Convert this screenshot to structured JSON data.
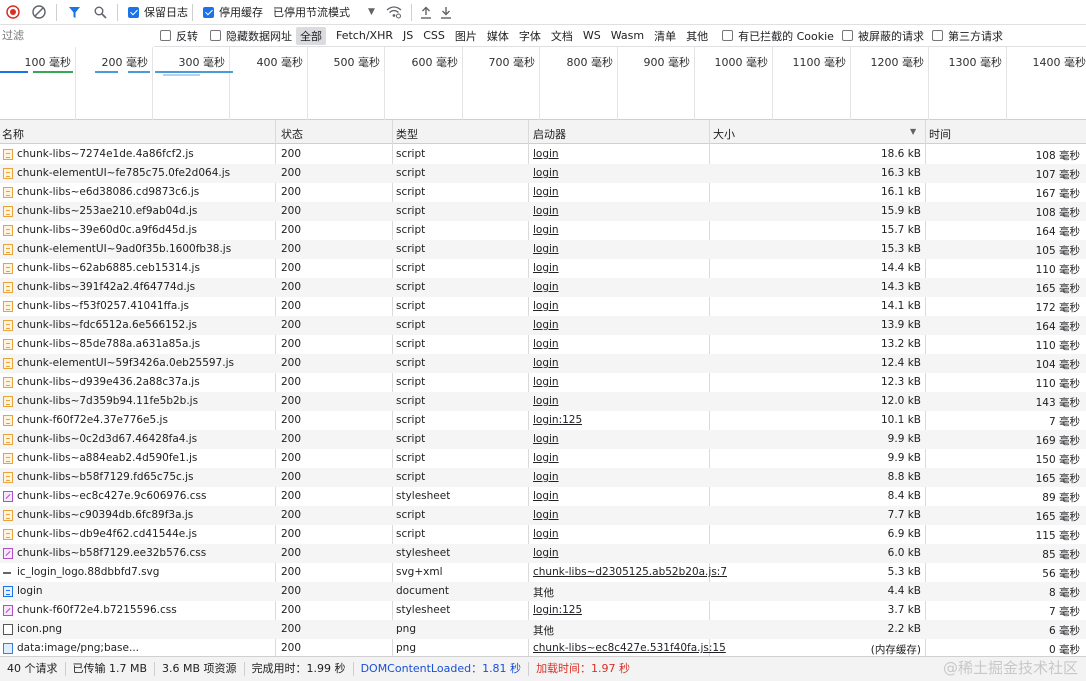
{
  "toolbar": {
    "preserve_log": "保留日志",
    "disable_cache": "停用缓存",
    "throttle": "已停用节流模式"
  },
  "filter": {
    "placeholder": "过滤",
    "invert": "反转",
    "hide_data_urls": "隐藏数据网址",
    "types": [
      "全部",
      "Fetch/XHR",
      "JS",
      "CSS",
      "图片",
      "媒体",
      "字体",
      "文档",
      "WS",
      "Wasm",
      "清单",
      "其他"
    ],
    "blocked_cookies": "有已拦截的 Cookie",
    "blocked_requests": "被屏蔽的请求",
    "third_party": "第三方请求"
  },
  "timeline": {
    "ticks": [
      "100 毫秒",
      "200 毫秒",
      "300 毫秒",
      "400 毫秒",
      "500 毫秒",
      "600 毫秒",
      "700 毫秒",
      "800 毫秒",
      "900 毫秒",
      "1000 毫秒",
      "1100 毫秒",
      "1200 毫秒",
      "1300 毫秒",
      "1400 毫秒"
    ]
  },
  "columns": {
    "name": "名称",
    "status": "状态",
    "type": "类型",
    "initiator": "启动器",
    "size": "大小",
    "time": "时间"
  },
  "requests": [
    {
      "name": "chunk-libs~7274e1de.4a86fcf2.js",
      "status": "200",
      "type": "script",
      "initiator": "login",
      "size": "18.6 kB",
      "time": "108 毫秒",
      "icon": "script"
    },
    {
      "name": "chunk-elementUI~fe785c75.0fe2d064.js",
      "status": "200",
      "type": "script",
      "initiator": "login",
      "size": "16.3 kB",
      "time": "107 毫秒",
      "icon": "script"
    },
    {
      "name": "chunk-libs~e6d38086.cd9873c6.js",
      "status": "200",
      "type": "script",
      "initiator": "login",
      "size": "16.1 kB",
      "time": "167 毫秒",
      "icon": "script"
    },
    {
      "name": "chunk-libs~253ae210.ef9ab04d.js",
      "status": "200",
      "type": "script",
      "initiator": "login",
      "size": "15.9 kB",
      "time": "108 毫秒",
      "icon": "script"
    },
    {
      "name": "chunk-libs~39e60d0c.a9f6d45d.js",
      "status": "200",
      "type": "script",
      "initiator": "login",
      "size": "15.7 kB",
      "time": "164 毫秒",
      "icon": "script"
    },
    {
      "name": "chunk-elementUI~9ad0f35b.1600fb38.js",
      "status": "200",
      "type": "script",
      "initiator": "login",
      "size": "15.3 kB",
      "time": "105 毫秒",
      "icon": "script"
    },
    {
      "name": "chunk-libs~62ab6885.ceb15314.js",
      "status": "200",
      "type": "script",
      "initiator": "login",
      "size": "14.4 kB",
      "time": "110 毫秒",
      "icon": "script"
    },
    {
      "name": "chunk-libs~391f42a2.4f64774d.js",
      "status": "200",
      "type": "script",
      "initiator": "login",
      "size": "14.3 kB",
      "time": "165 毫秒",
      "icon": "script"
    },
    {
      "name": "chunk-libs~f53f0257.41041ffa.js",
      "status": "200",
      "type": "script",
      "initiator": "login",
      "size": "14.1 kB",
      "time": "172 毫秒",
      "icon": "script"
    },
    {
      "name": "chunk-libs~fdc6512a.6e566152.js",
      "status": "200",
      "type": "script",
      "initiator": "login",
      "size": "13.9 kB",
      "time": "164 毫秒",
      "icon": "script"
    },
    {
      "name": "chunk-libs~85de788a.a631a85a.js",
      "status": "200",
      "type": "script",
      "initiator": "login",
      "size": "13.2 kB",
      "time": "110 毫秒",
      "icon": "script"
    },
    {
      "name": "chunk-elementUI~59f3426a.0eb25597.js",
      "status": "200",
      "type": "script",
      "initiator": "login",
      "size": "12.4 kB",
      "time": "104 毫秒",
      "icon": "script"
    },
    {
      "name": "chunk-libs~d939e436.2a88c37a.js",
      "status": "200",
      "type": "script",
      "initiator": "login",
      "size": "12.3 kB",
      "time": "110 毫秒",
      "icon": "script"
    },
    {
      "name": "chunk-libs~7d359b94.11fe5b2b.js",
      "status": "200",
      "type": "script",
      "initiator": "login",
      "size": "12.0 kB",
      "time": "143 毫秒",
      "icon": "script"
    },
    {
      "name": "chunk-f60f72e4.37e776e5.js",
      "status": "200",
      "type": "script",
      "initiator": "login:125",
      "size": "10.1 kB",
      "time": "7 毫秒",
      "icon": "script"
    },
    {
      "name": "chunk-libs~0c2d3d67.46428fa4.js",
      "status": "200",
      "type": "script",
      "initiator": "login",
      "size": "9.9 kB",
      "time": "169 毫秒",
      "icon": "script"
    },
    {
      "name": "chunk-libs~a884eab2.4d590fe1.js",
      "status": "200",
      "type": "script",
      "initiator": "login",
      "size": "9.9 kB",
      "time": "150 毫秒",
      "icon": "script"
    },
    {
      "name": "chunk-libs~b58f7129.fd65c75c.js",
      "status": "200",
      "type": "script",
      "initiator": "login",
      "size": "8.8 kB",
      "time": "165 毫秒",
      "icon": "script"
    },
    {
      "name": "chunk-libs~ec8c427e.9c606976.css",
      "status": "200",
      "type": "stylesheet",
      "initiator": "login",
      "size": "8.4 kB",
      "time": "89 毫秒",
      "icon": "css"
    },
    {
      "name": "chunk-libs~c90394db.6fc89f3a.js",
      "status": "200",
      "type": "script",
      "initiator": "login",
      "size": "7.7 kB",
      "time": "165 毫秒",
      "icon": "script"
    },
    {
      "name": "chunk-libs~db9e4f62.cd41544e.js",
      "status": "200",
      "type": "script",
      "initiator": "login",
      "size": "6.9 kB",
      "time": "115 毫秒",
      "icon": "script"
    },
    {
      "name": "chunk-libs~b58f7129.ee32b576.css",
      "status": "200",
      "type": "stylesheet",
      "initiator": "login",
      "size": "6.0 kB",
      "time": "85 毫秒",
      "icon": "css"
    },
    {
      "name": "ic_login_logo.88dbbfd7.svg",
      "status": "200",
      "type": "svg+xml",
      "initiator": "chunk-libs~d2305125.ab52b20a.js:7",
      "size": "5.3 kB",
      "time": "56 毫秒",
      "icon": "svg"
    },
    {
      "name": "login",
      "status": "200",
      "type": "document",
      "initiator": "其他",
      "size": "4.4 kB",
      "time": "8 毫秒",
      "icon": "doc"
    },
    {
      "name": "chunk-f60f72e4.b7215596.css",
      "status": "200",
      "type": "stylesheet",
      "initiator": "login:125",
      "size": "3.7 kB",
      "time": "7 毫秒",
      "icon": "css"
    },
    {
      "name": "icon.png",
      "status": "200",
      "type": "png",
      "initiator": "其他",
      "size": "2.2 kB",
      "time": "6 毫秒",
      "icon": "png"
    },
    {
      "name": "data:image/png;base...",
      "status": "200",
      "type": "png",
      "initiator": "chunk-libs~ec8c427e.531f40fa.js:15",
      "size": "(内存缓存)",
      "time": "0 毫秒",
      "icon": "img"
    }
  ],
  "status": {
    "requests": "40 个请求",
    "transferred": "已传输 1.7 MB",
    "resources": "3.6 MB 项资源",
    "finish": "完成用时：1.99 秒",
    "dcl": "DOMContentLoaded：1.81 秒",
    "load": "加载时间：1.97 秒"
  },
  "watermark": "@稀土掘金技术社区",
  "colors": {
    "record": "#d93025",
    "filter": "#1a73e8",
    "dcl": "#1a4fd6",
    "load": "#d93025"
  }
}
